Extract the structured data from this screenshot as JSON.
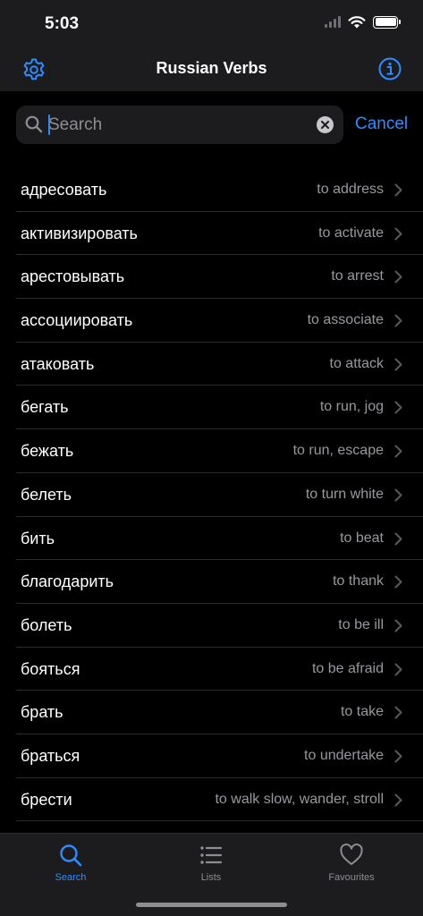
{
  "status": {
    "time": "5:03"
  },
  "nav": {
    "title": "Russian Verbs",
    "left_icon": "gear-icon",
    "right_icon": "info-icon"
  },
  "search": {
    "placeholder": "Search",
    "value": "",
    "cancel_label": "Cancel"
  },
  "verbs": [
    {
      "ru": "адресовать",
      "en": "to address"
    },
    {
      "ru": "активизировать",
      "en": "to activate"
    },
    {
      "ru": "арестовывать",
      "en": "to arrest"
    },
    {
      "ru": "ассоциировать",
      "en": "to associate"
    },
    {
      "ru": "атаковать",
      "en": "to attack"
    },
    {
      "ru": "бегать",
      "en": "to run, jog"
    },
    {
      "ru": "бежать",
      "en": "to run,  escape"
    },
    {
      "ru": "белеть",
      "en": "to turn white"
    },
    {
      "ru": "бить",
      "en": "to beat"
    },
    {
      "ru": "благодарить",
      "en": "to thank"
    },
    {
      "ru": "болеть",
      "en": "to be ill"
    },
    {
      "ru": "бояться",
      "en": "to be afraid"
    },
    {
      "ru": "брать",
      "en": "to take"
    },
    {
      "ru": "браться",
      "en": "to undertake"
    },
    {
      "ru": "брести",
      "en": "to walk slow, wander, stroll"
    }
  ],
  "tabs": [
    {
      "label": "Search",
      "icon": "search-icon",
      "active": true
    },
    {
      "label": "Lists",
      "icon": "list-icon",
      "active": false
    },
    {
      "label": "Favourites",
      "icon": "heart-icon",
      "active": false
    }
  ],
  "colors": {
    "accent": "#2f8cff",
    "background": "#000000",
    "bar": "#1c1c1e",
    "secondary_text": "#98989e"
  }
}
